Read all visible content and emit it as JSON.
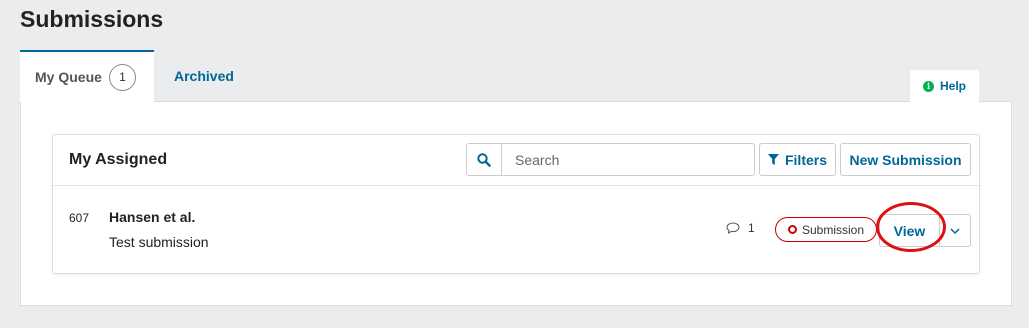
{
  "page": {
    "title": "Submissions"
  },
  "tabs": {
    "my_queue_label": "My Queue",
    "my_queue_count": "1",
    "archived_label": "Archived"
  },
  "help": {
    "label": "Help",
    "icon": "info-icon"
  },
  "list": {
    "title": "My Assigned",
    "search_placeholder": "Search",
    "filters_label": "Filters",
    "new_submission_label": "New Submission"
  },
  "submissions": [
    {
      "id": "607",
      "author": "Hansen et al.",
      "title": "Test submission",
      "comment_count": "1",
      "stage": "Submission",
      "view_label": "View"
    }
  ],
  "colors": {
    "accent": "#006798",
    "stage_border": "#cc0000",
    "annotation": "#dd1111",
    "help_icon": "#00b24e"
  }
}
